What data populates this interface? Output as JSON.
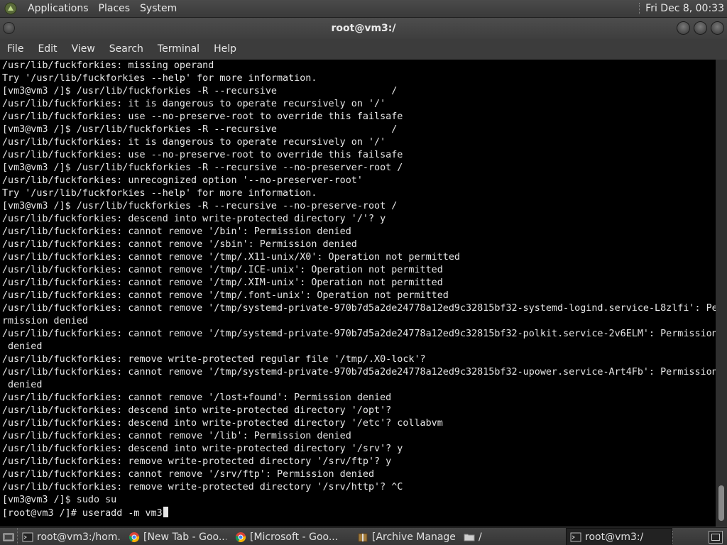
{
  "top_panel": {
    "menus": [
      "Applications",
      "Places",
      "System"
    ],
    "clock": "Fri Dec  8, 00:33"
  },
  "window": {
    "title": "root@vm3:/",
    "menu": [
      "File",
      "Edit",
      "View",
      "Search",
      "Terminal",
      "Help"
    ]
  },
  "terminal": {
    "lines": [
      "/usr/lib/fuckforkies: missing operand",
      "Try '/usr/lib/fuckforkies --help' for more information.",
      "[vm3@vm3 /]$ /usr/lib/fuckforkies -R --recursive                    /",
      "/usr/lib/fuckforkies: it is dangerous to operate recursively on '/'",
      "/usr/lib/fuckforkies: use --no-preserve-root to override this failsafe",
      "[vm3@vm3 /]$ /usr/lib/fuckforkies -R --recursive                    /",
      "/usr/lib/fuckforkies: it is dangerous to operate recursively on '/'",
      "/usr/lib/fuckforkies: use --no-preserve-root to override this failsafe",
      "[vm3@vm3 /]$ /usr/lib/fuckforkies -R --recursive --no-preserver-root /",
      "/usr/lib/fuckforkies: unrecognized option '--no-preserver-root'",
      "Try '/usr/lib/fuckforkies --help' for more information.",
      "[vm3@vm3 /]$ /usr/lib/fuckforkies -R --recursive --no-preserve-root /",
      "/usr/lib/fuckforkies: descend into write-protected directory '/'? y",
      "/usr/lib/fuckforkies: cannot remove '/bin': Permission denied",
      "/usr/lib/fuckforkies: cannot remove '/sbin': Permission denied",
      "/usr/lib/fuckforkies: cannot remove '/tmp/.X11-unix/X0': Operation not permitted",
      "/usr/lib/fuckforkies: cannot remove '/tmp/.ICE-unix': Operation not permitted",
      "/usr/lib/fuckforkies: cannot remove '/tmp/.XIM-unix': Operation not permitted",
      "/usr/lib/fuckforkies: cannot remove '/tmp/.font-unix': Operation not permitted",
      "/usr/lib/fuckforkies: cannot remove '/tmp/systemd-private-970b7d5a2de24778a12ed9c32815bf32-systemd-logind.service-L8zlfi': Pe",
      "rmission denied",
      "/usr/lib/fuckforkies: cannot remove '/tmp/systemd-private-970b7d5a2de24778a12ed9c32815bf32-polkit.service-2v6ELM': Permission",
      " denied",
      "/usr/lib/fuckforkies: remove write-protected regular file '/tmp/.X0-lock'?",
      "/usr/lib/fuckforkies: cannot remove '/tmp/systemd-private-970b7d5a2de24778a12ed9c32815bf32-upower.service-Art4Fb': Permission",
      " denied",
      "/usr/lib/fuckforkies: cannot remove '/lost+found': Permission denied",
      "/usr/lib/fuckforkies: descend into write-protected directory '/opt'?",
      "/usr/lib/fuckforkies: descend into write-protected directory '/etc'? collabvm",
      "/usr/lib/fuckforkies: cannot remove '/lib': Permission denied",
      "/usr/lib/fuckforkies: descend into write-protected directory '/srv'? y",
      "/usr/lib/fuckforkies: remove write-protected directory '/srv/ftp'? y",
      "/usr/lib/fuckforkies: cannot remove '/srv/ftp': Permission denied",
      "/usr/lib/fuckforkies: remove write-protected directory '/srv/http'? ^C",
      "[vm3@vm3 /]$ sudo su"
    ],
    "prompt_line": "[root@vm3 /]# useradd -m vm3"
  },
  "taskbar": {
    "tasks": [
      {
        "label": "root@vm3:/hom...",
        "icon": "terminal-icon"
      },
      {
        "label": "[New Tab - Goo...",
        "icon": "chrome-icon"
      },
      {
        "label": "[Microsoft - Goo...",
        "icon": "chrome-icon"
      },
      {
        "label": "[Archive Manager]",
        "icon": "archive-manager-icon"
      },
      {
        "label": "/",
        "icon": "folder-icon"
      },
      {
        "label": "root@vm3:/",
        "icon": "terminal-icon"
      }
    ]
  },
  "colors": {
    "terminal_bg": "#000000",
    "terminal_fg": "#e6e6e6",
    "panel_bg": "#3a3a3a"
  }
}
